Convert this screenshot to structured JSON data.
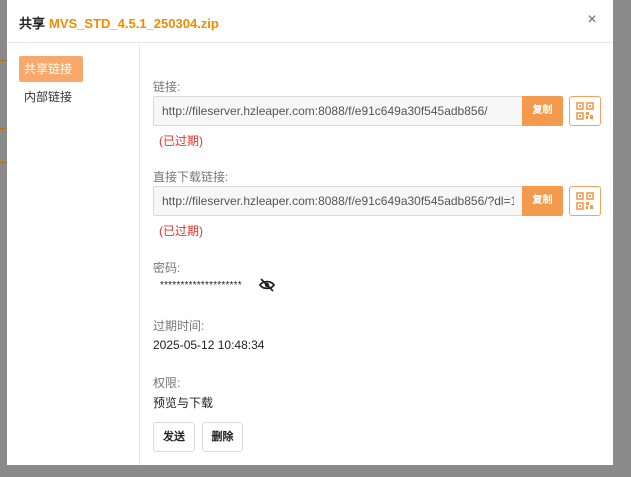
{
  "dialog": {
    "title_prefix": "共享",
    "file_name": "MVS_STD_4.5.1_250304.zip",
    "close_icon": "×"
  },
  "sidebar": {
    "items": [
      {
        "label": "共享链接",
        "active": true
      },
      {
        "label": "内部链接",
        "active": false
      }
    ]
  },
  "link": {
    "label": "链接:",
    "value": "http://fileserver.hzleaper.com:8088/f/e91c649a30f545adb856/",
    "copy_label": "复制",
    "status": "(已过期)"
  },
  "direct_link": {
    "label": "直接下载链接:",
    "value": "http://fileserver.hzleaper.com:8088/f/e91c649a30f545adb856/?dl=1",
    "copy_label": "复制",
    "status": "(已过期)"
  },
  "password": {
    "label": "密码:",
    "masked_value": "********************"
  },
  "expiration": {
    "label": "过期时间:",
    "value": "2025-05-12 10:48:34"
  },
  "permission": {
    "label": "权限:",
    "value": "预览与下载"
  },
  "actions": {
    "send_label": "发送",
    "delete_label": "删除"
  },
  "colors": {
    "accent": "#f39a4f",
    "file_name": "#f08c00",
    "expired": "#e8312a"
  }
}
